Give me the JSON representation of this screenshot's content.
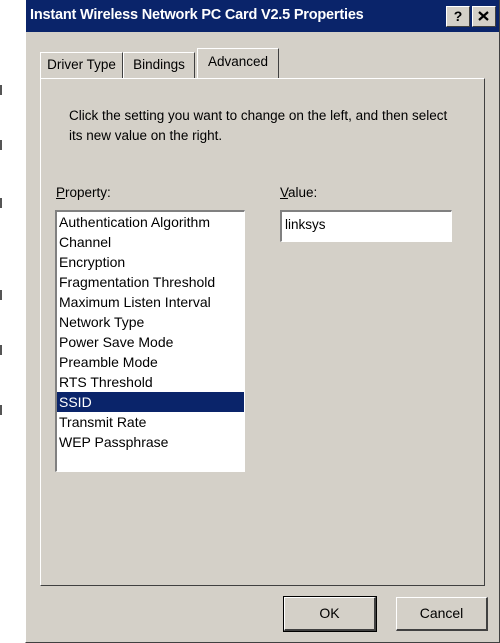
{
  "window": {
    "title": "Instant Wireless Network PC Card V2.5 Properties",
    "help_glyph": "?",
    "close_glyph": "×"
  },
  "tabs": [
    {
      "label": "Driver Type",
      "active": false
    },
    {
      "label": "Bindings",
      "active": false
    },
    {
      "label": "Advanced",
      "active": true
    }
  ],
  "advanced": {
    "instructions": "Click the setting you want to change on the left, and then select its new value on the right.",
    "property_label": {
      "mnemonic": "P",
      "rest": "roperty:"
    },
    "value_label": {
      "mnemonic": "V",
      "rest": "alue:"
    },
    "properties": [
      "Authentication Algorithm",
      "Channel",
      "Encryption",
      "Fragmentation Threshold",
      "Maximum Listen Interval",
      "Network Type",
      "Power Save Mode",
      "Preamble Mode",
      "RTS Threshold",
      "SSID",
      "Transmit Rate",
      "WEP Passphrase"
    ],
    "selected_property": "SSID",
    "value": "linksys"
  },
  "buttons": {
    "ok": "OK",
    "cancel": "Cancel"
  },
  "colors": {
    "titlebar": "#0a246a",
    "face": "#d4d0c8",
    "selection": "#0a246a"
  }
}
